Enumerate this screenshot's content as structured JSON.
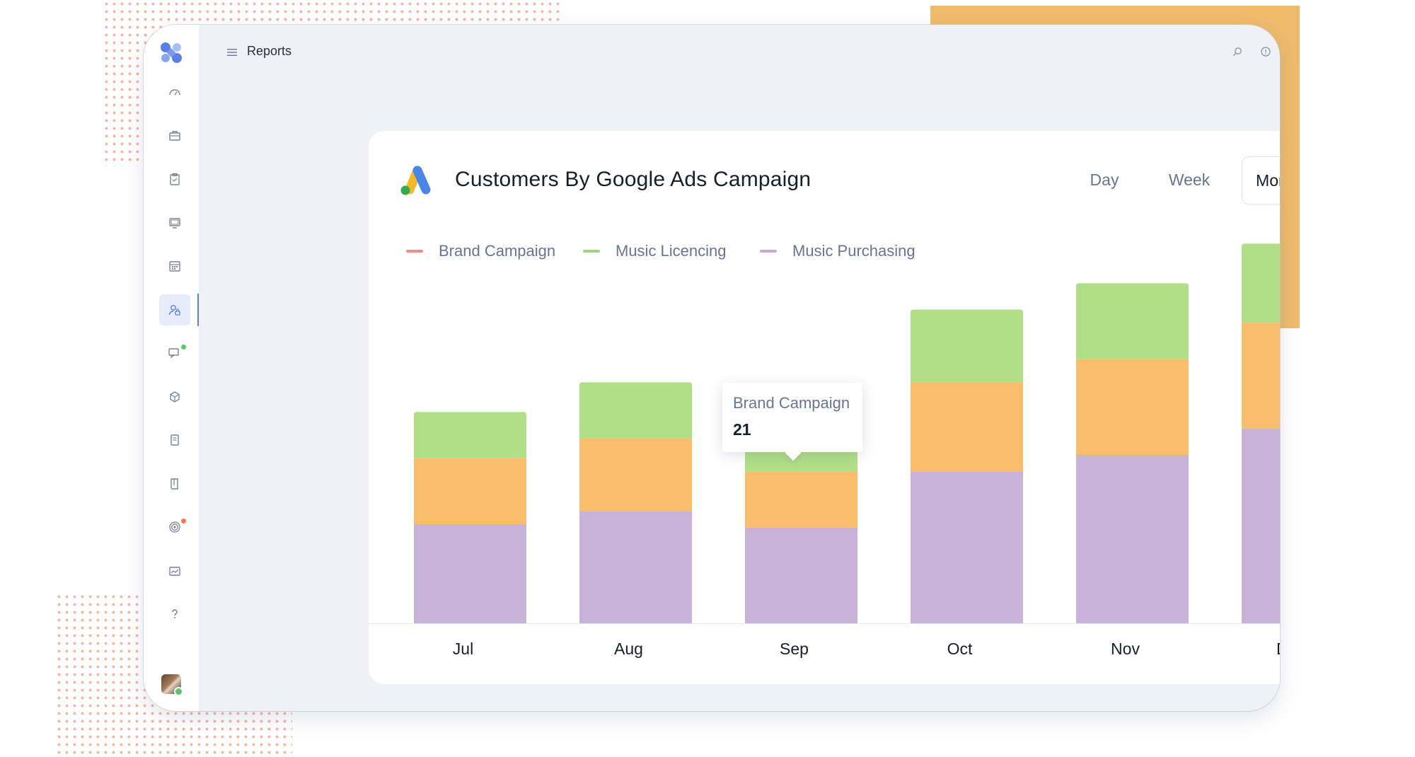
{
  "header": {
    "page_title": "Reports"
  },
  "sidebar": {
    "items": [
      {
        "name": "dashboard",
        "icon": "speedometer-icon"
      },
      {
        "name": "briefcase",
        "icon": "briefcase-icon"
      },
      {
        "name": "tasks",
        "icon": "clipboard-check-icon"
      },
      {
        "name": "campaigns",
        "icon": "monitor-icon"
      },
      {
        "name": "calendar",
        "icon": "calendar-icon"
      },
      {
        "name": "contacts",
        "icon": "user-lock-icon",
        "active": true
      },
      {
        "name": "chat",
        "icon": "chat-monitor-icon",
        "badge_color": "#62c46a"
      },
      {
        "name": "products",
        "icon": "cube-icon"
      },
      {
        "name": "invoices",
        "icon": "receipt-icon"
      },
      {
        "name": "docs",
        "icon": "book-icon"
      },
      {
        "name": "goals",
        "icon": "target-icon",
        "badge_color": "#f07a4f"
      },
      {
        "name": "reports",
        "icon": "chart-icon"
      },
      {
        "name": "help",
        "icon": "question-icon"
      }
    ]
  },
  "card": {
    "title": "Customers By Google Ads Campaign",
    "tabs": [
      {
        "label": "Day",
        "active": false
      },
      {
        "label": "Week",
        "active": false
      },
      {
        "label": "Month",
        "active": true
      }
    ]
  },
  "tooltip": {
    "label": "Brand Campaign",
    "value": "21"
  },
  "chart_data": {
    "type": "bar",
    "stacked": true,
    "categories": [
      "Jul",
      "Aug",
      "Sep",
      "Oct",
      "Nov",
      "Dec"
    ],
    "series": [
      {
        "name": "Music Purchasing",
        "color": "#c9b2d9",
        "values": [
          30,
          34,
          29,
          46,
          51,
          59
        ]
      },
      {
        "name": "Brand Campaign",
        "color": "#f9bd6c",
        "values": [
          20,
          22,
          17,
          27,
          29,
          32
        ]
      },
      {
        "name": "Music Licencing",
        "color": "#b1df88",
        "values": [
          14,
          17,
          19,
          22,
          23,
          24
        ]
      }
    ],
    "legend": [
      {
        "name": "Brand Campaign",
        "color": "#f08c82"
      },
      {
        "name": "Music Licencing",
        "color": "#9bd77c"
      },
      {
        "name": "Music Purchasing",
        "color": "#c9a8d9"
      }
    ],
    "ylim": [
      0,
      120
    ],
    "grid": false,
    "legend_position": "top-left"
  }
}
